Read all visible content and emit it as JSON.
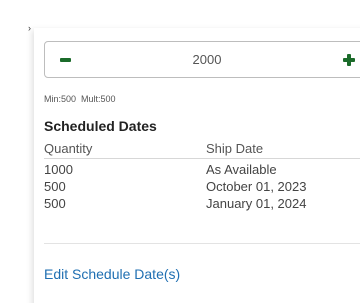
{
  "stepper": {
    "value": "2000",
    "decrement_icon": "minus-icon",
    "increment_icon": "plus-icon",
    "accent_color": "#1b6b2a"
  },
  "constraints": {
    "min_label": "Min:500",
    "mult_label": "Mult:500"
  },
  "schedule": {
    "title": "Scheduled Dates",
    "columns": [
      "Quantity",
      "Ship Date"
    ],
    "rows": [
      {
        "quantity": "1000",
        "ship_date": "As Available"
      },
      {
        "quantity": "500",
        "ship_date": "October 01, 2023"
      },
      {
        "quantity": "500",
        "ship_date": "January 01, 2024"
      }
    ]
  },
  "edit_link": {
    "label": "Edit Schedule Date(s)",
    "color": "#1f6fb2"
  }
}
